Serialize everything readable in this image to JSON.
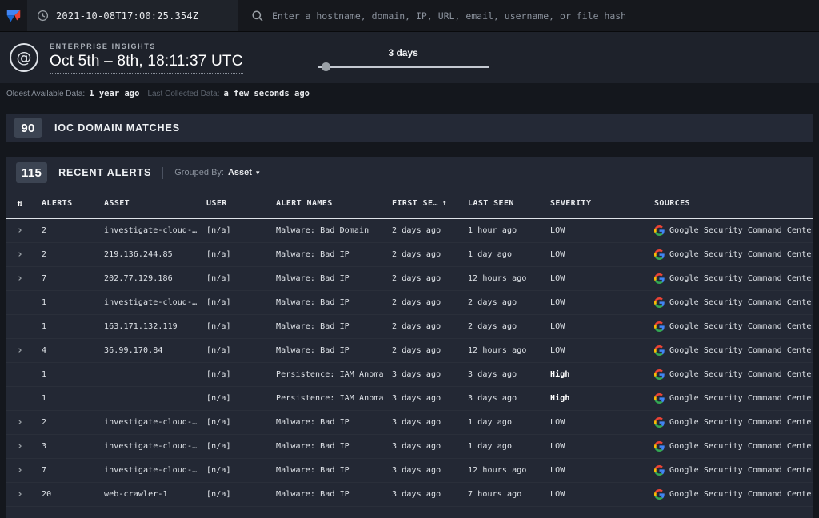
{
  "topbar": {
    "timestamp": "2021-10-08T17:00:25.354Z",
    "search_placeholder": "Enter a hostname, domain, IP, URL, email, username, or file hash"
  },
  "insights": {
    "eyebrow": "ENTERPRISE INSIGHTS",
    "title": "Oct 5th – 8th, 18:11:37 UTC",
    "slider_label": "3 days",
    "oldest_available_label": "Oldest Available Data:",
    "oldest_available_value": "1 year ago",
    "last_collected_label": "Last Collected Data:",
    "last_collected_value": "a few seconds ago"
  },
  "ioc_section": {
    "count": "90",
    "title": "IOC DOMAIN MATCHES"
  },
  "alerts_section": {
    "count": "115",
    "title": "RECENT ALERTS",
    "grouped_by_label": "Grouped By:",
    "grouped_by_value": "Asset"
  },
  "table": {
    "headers": {
      "alerts": "ALERTS",
      "asset": "ASSET",
      "user": "USER",
      "alert_names": "ALERT NAMES",
      "first_seen": "FIRST SE…",
      "sort_direction": "↑",
      "last_seen": "LAST SEEN",
      "severity": "SEVERITY",
      "sources": "SOURCES"
    },
    "rows": [
      {
        "expandable": true,
        "alerts": "2",
        "asset": "investigate-cloud-…",
        "user": "[n/a]",
        "alert_names": "Malware: Bad Domain",
        "first_seen": "2 days ago",
        "last_seen": "1 hour ago",
        "severity": "LOW",
        "source": "Google Security Command Center"
      },
      {
        "expandable": true,
        "alerts": "2",
        "asset": "219.136.244.85",
        "user": "[n/a]",
        "alert_names": "Malware: Bad IP",
        "first_seen": "2 days ago",
        "last_seen": "1 day ago",
        "severity": "LOW",
        "source": "Google Security Command Center"
      },
      {
        "expandable": true,
        "alerts": "7",
        "asset": "202.77.129.186",
        "user": "[n/a]",
        "alert_names": "Malware: Bad IP",
        "first_seen": "2 days ago",
        "last_seen": "12 hours ago",
        "severity": "LOW",
        "source": "Google Security Command Center"
      },
      {
        "expandable": false,
        "alerts": "1",
        "asset": "investigate-cloud-…",
        "user": "[n/a]",
        "alert_names": "Malware: Bad IP",
        "first_seen": "2 days ago",
        "last_seen": "2 days ago",
        "severity": "LOW",
        "source": "Google Security Command Center"
      },
      {
        "expandable": false,
        "alerts": "1",
        "asset": "163.171.132.119",
        "user": "[n/a]",
        "alert_names": "Malware: Bad IP",
        "first_seen": "2 days ago",
        "last_seen": "2 days ago",
        "severity": "LOW",
        "source": "Google Security Command Center"
      },
      {
        "expandable": true,
        "alerts": "4",
        "asset": "36.99.170.84",
        "user": "[n/a]",
        "alert_names": "Malware: Bad IP",
        "first_seen": "2 days ago",
        "last_seen": "12 hours ago",
        "severity": "LOW",
        "source": "Google Security Command Center"
      },
      {
        "expandable": false,
        "alerts": "1",
        "asset": "",
        "user": "[n/a]",
        "alert_names": "Persistence: IAM Anoma…",
        "first_seen": "3 days ago",
        "last_seen": "3 days ago",
        "severity": "High",
        "source": "Google Security Command Center"
      },
      {
        "expandable": false,
        "alerts": "1",
        "asset": "",
        "user": "[n/a]",
        "alert_names": "Persistence: IAM Anoma…",
        "first_seen": "3 days ago",
        "last_seen": "3 days ago",
        "severity": "High",
        "source": "Google Security Command Center"
      },
      {
        "expandable": true,
        "alerts": "2",
        "asset": "investigate-cloud-…",
        "user": "[n/a]",
        "alert_names": "Malware: Bad IP",
        "first_seen": "3 days ago",
        "last_seen": "1 day ago",
        "severity": "LOW",
        "source": "Google Security Command Center"
      },
      {
        "expandable": true,
        "alerts": "3",
        "asset": "investigate-cloud-…",
        "user": "[n/a]",
        "alert_names": "Malware: Bad IP",
        "first_seen": "3 days ago",
        "last_seen": "1 day ago",
        "severity": "LOW",
        "source": "Google Security Command Center"
      },
      {
        "expandable": true,
        "alerts": "7",
        "asset": "investigate-cloud-…",
        "user": "[n/a]",
        "alert_names": "Malware: Bad IP",
        "first_seen": "3 days ago",
        "last_seen": "12 hours ago",
        "severity": "LOW",
        "source": "Google Security Command Center"
      },
      {
        "expandable": true,
        "alerts": "20",
        "asset": "web-crawler-1",
        "user": "[n/a]",
        "alert_names": "Malware: Bad IP",
        "first_seen": "3 days ago",
        "last_seen": "7 hours ago",
        "severity": "LOW",
        "source": "Google Security Command Center"
      }
    ]
  }
}
